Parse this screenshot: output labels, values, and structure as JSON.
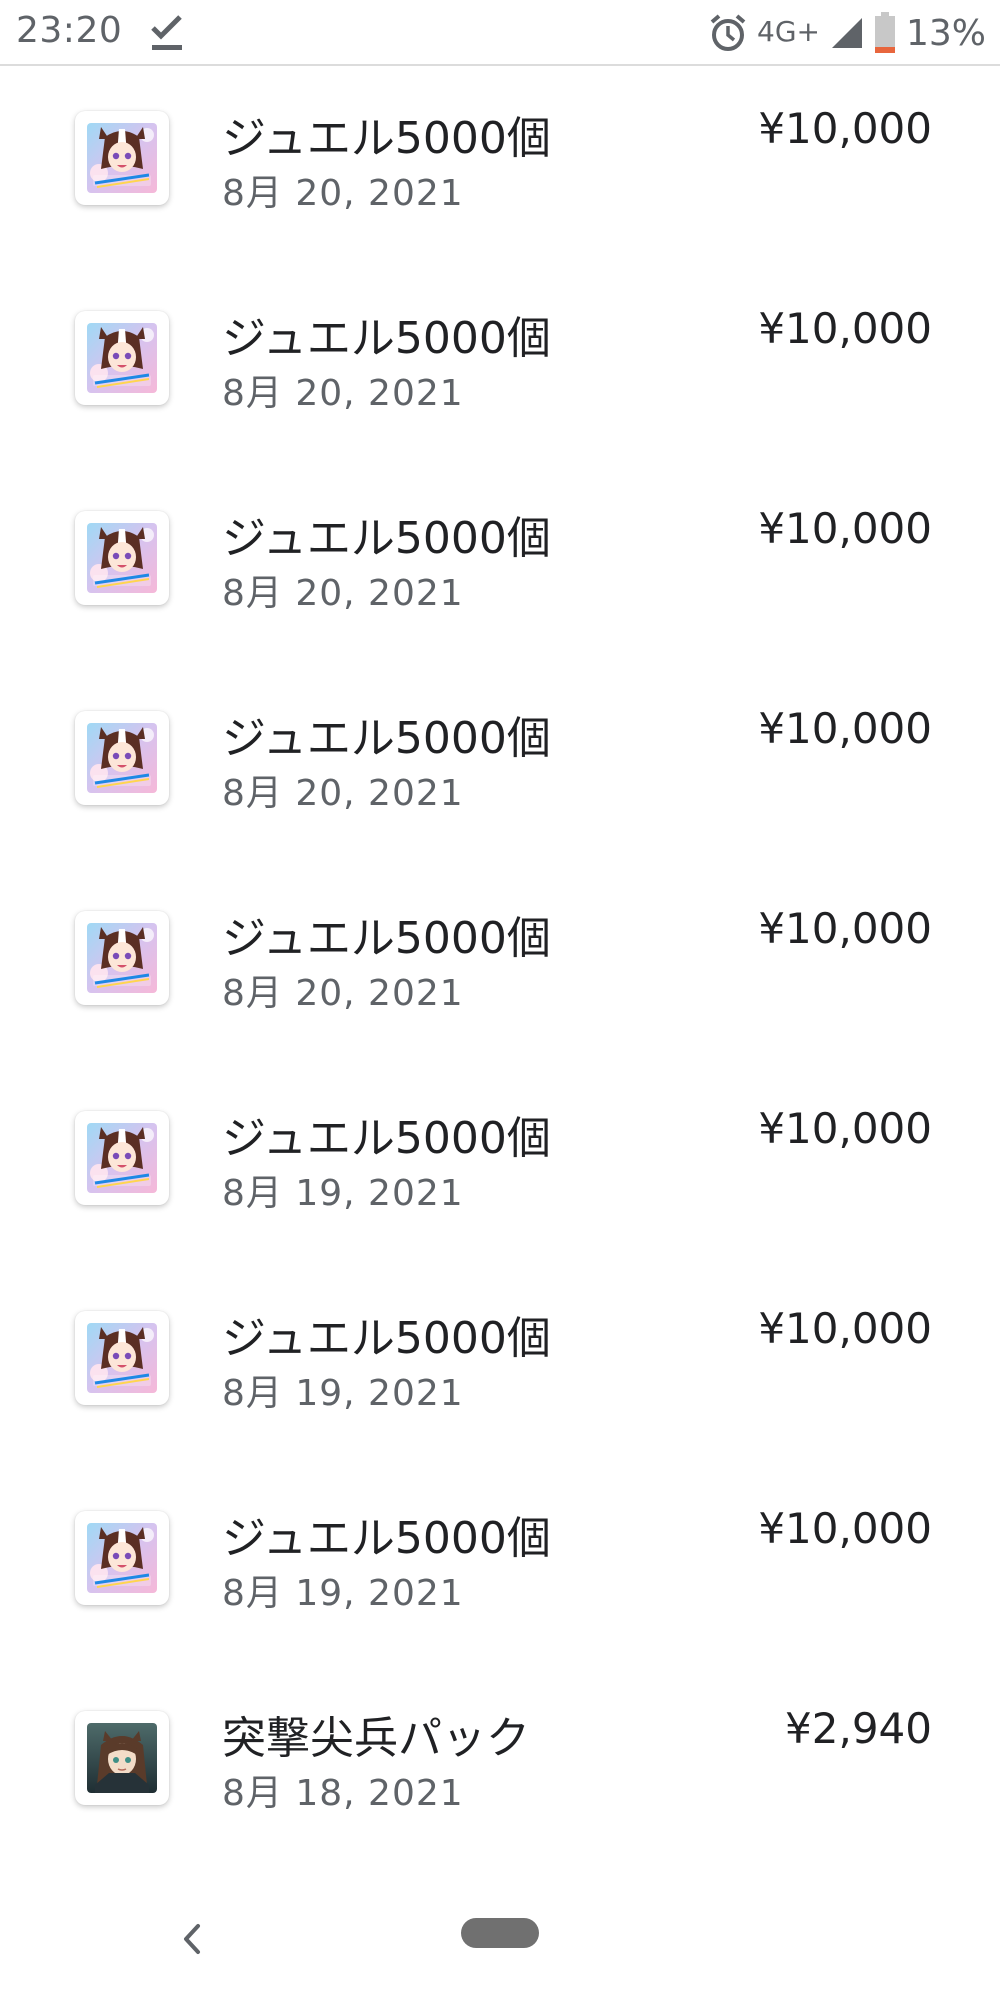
{
  "status_bar": {
    "time": "23:20",
    "network": "4G+",
    "battery": "13%",
    "icons": [
      "download-done-icon",
      "alarm-icon",
      "signal-icon",
      "battery-icon"
    ],
    "battery_color": "#e8663d"
  },
  "purchases": [
    {
      "title": "ジュエル5000個",
      "date": "8月 20, 2021",
      "price": "¥10,000",
      "icon": "uma-musume-app-icon"
    },
    {
      "title": "ジュエル5000個",
      "date": "8月 20, 2021",
      "price": "¥10,000",
      "icon": "uma-musume-app-icon"
    },
    {
      "title": "ジュエル5000個",
      "date": "8月 20, 2021",
      "price": "¥10,000",
      "icon": "uma-musume-app-icon"
    },
    {
      "title": "ジュエル5000個",
      "date": "8月 20, 2021",
      "price": "¥10,000",
      "icon": "uma-musume-app-icon"
    },
    {
      "title": "ジュエル5000個",
      "date": "8月 20, 2021",
      "price": "¥10,000",
      "icon": "uma-musume-app-icon"
    },
    {
      "title": "ジュエル5000個",
      "date": "8月 19, 2021",
      "price": "¥10,000",
      "icon": "uma-musume-app-icon"
    },
    {
      "title": "ジュエル5000個",
      "date": "8月 19, 2021",
      "price": "¥10,000",
      "icon": "uma-musume-app-icon"
    },
    {
      "title": "ジュエル5000個",
      "date": "8月 19, 2021",
      "price": "¥10,000",
      "icon": "uma-musume-app-icon"
    },
    {
      "title": "突撃尖兵パック",
      "date": "8月 18, 2021",
      "price": "¥2,940",
      "icon": "arknights-app-icon"
    }
  ],
  "nav_bar": {
    "icons": [
      "back-chevron-icon",
      "home-pill-icon"
    ]
  }
}
